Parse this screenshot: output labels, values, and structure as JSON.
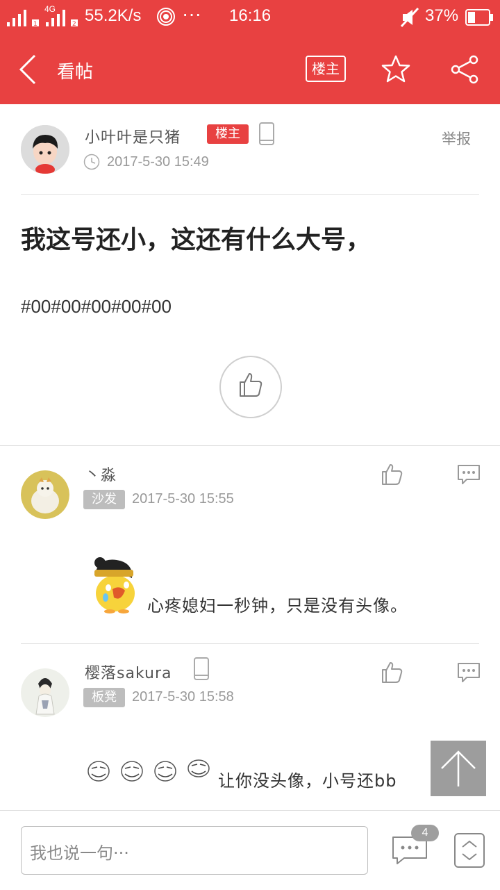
{
  "statusbar": {
    "network_type": "4G",
    "speed": "55.2K/s",
    "dots": "···",
    "time": "16:16",
    "battery": "37%"
  },
  "header": {
    "title": "看帖",
    "op_badge": "楼主"
  },
  "post": {
    "author": "小叶叶是只猪",
    "op_tag": "楼主",
    "report": "举报",
    "time": "2017-5-30 15:49",
    "title": "我这号还小，这还有什么大号，",
    "body": "#00#00#00#00#00"
  },
  "replies": [
    {
      "author": "丶淼",
      "floor_tag": "沙发",
      "time": "2017-5-30 15:55",
      "text": "心疼媳妇一秒钟，只是没有头像。"
    },
    {
      "author": "樱落sakura",
      "floor_tag": "板凳",
      "time": "2017-5-30 15:58",
      "text": "让你没头像，小号还bb"
    }
  ],
  "bottombar": {
    "placeholder": "我也说一句···",
    "comment_count": "4"
  },
  "colors": {
    "accent": "#e84141",
    "tag_gray": "#bdbdbd"
  }
}
